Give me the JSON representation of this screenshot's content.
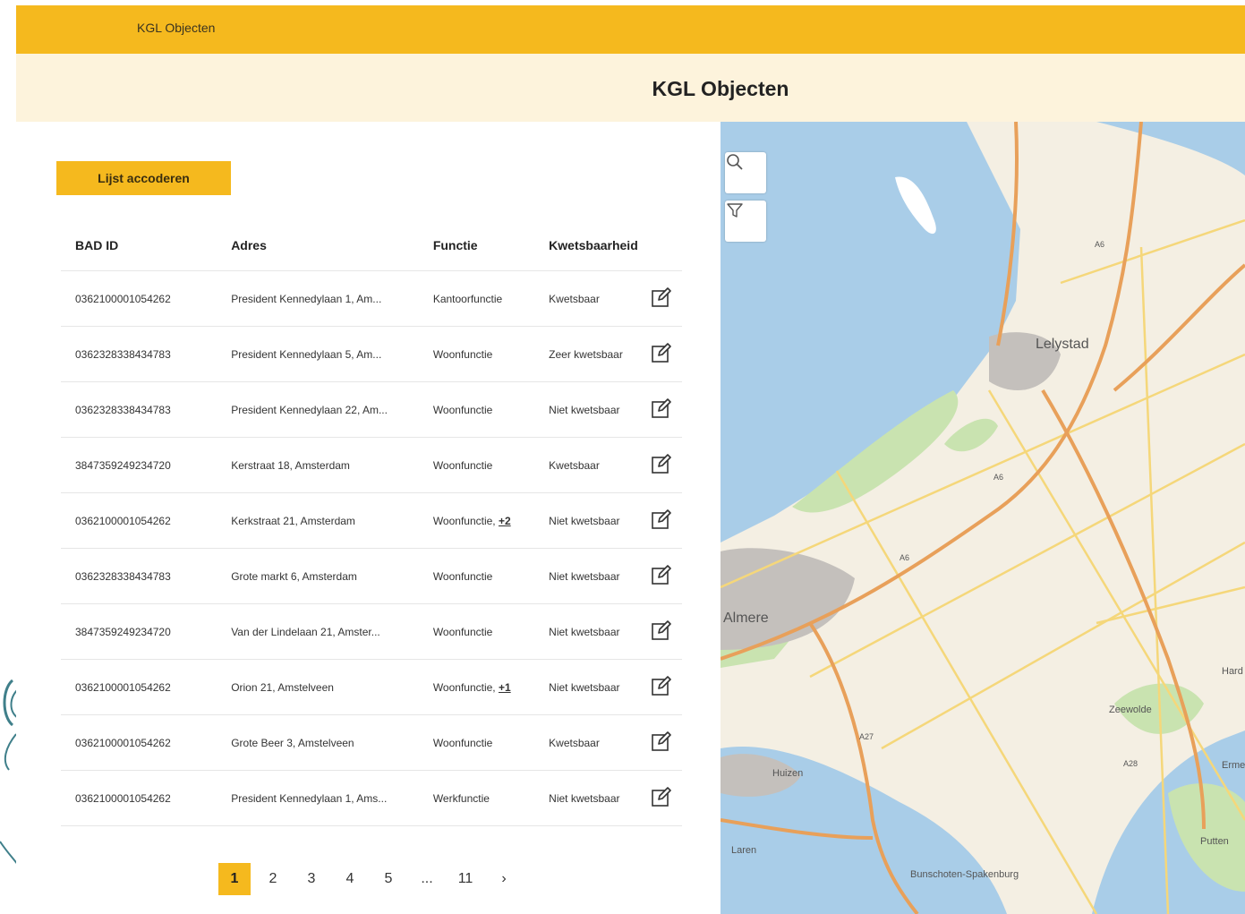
{
  "header": {
    "app_name": "KGL Objecten"
  },
  "page": {
    "title": "KGL Objecten"
  },
  "actions": {
    "accept_label": "Lijst accoderen"
  },
  "table": {
    "columns": [
      "BAD ID",
      "Adres",
      "Functie",
      "Kwetsbaarheid"
    ],
    "rows": [
      {
        "id": "0362100001054262",
        "address": "President Kennedylaan 1, Am...",
        "function": "Kantoorfunctie",
        "more": "",
        "vulnerability": "Kwetsbaar"
      },
      {
        "id": "0362328338434783",
        "address": "President Kennedylaan 5, Am...",
        "function": "Woonfunctie",
        "more": "",
        "vulnerability": "Zeer kwetsbaar"
      },
      {
        "id": "0362328338434783",
        "address": "President Kennedylaan 22, Am...",
        "function": "Woonfunctie",
        "more": "",
        "vulnerability": "Niet kwetsbaar"
      },
      {
        "id": "3847359249234720",
        "address": "Kerstraat 18, Amsterdam",
        "function": "Woonfunctie",
        "more": "",
        "vulnerability": "Kwetsbaar"
      },
      {
        "id": "0362100001054262",
        "address": "Kerkstraat 21, Amsterdam",
        "function": "Woonfunctie, ",
        "more": "+2",
        "vulnerability": "Niet kwetsbaar"
      },
      {
        "id": "0362328338434783",
        "address": "Grote markt 6, Amsterdam",
        "function": "Woonfunctie",
        "more": "",
        "vulnerability": "Niet kwetsbaar"
      },
      {
        "id": "3847359249234720",
        "address": "Van der Lindelaan 21, Amster...",
        "function": "Woonfunctie",
        "more": "",
        "vulnerability": "Niet kwetsbaar"
      },
      {
        "id": "0362100001054262",
        "address": "Orion 21, Amstelveen",
        "function": "Woonfunctie, ",
        "more": "+1",
        "vulnerability": "Niet kwetsbaar"
      },
      {
        "id": "0362100001054262",
        "address": "Grote Beer 3, Amstelveen",
        "function": "Woonfunctie",
        "more": "",
        "vulnerability": "Kwetsbaar"
      },
      {
        "id": "0362100001054262",
        "address": "President Kennedylaan 1, Ams...",
        "function": "Werkfunctie",
        "more": "",
        "vulnerability": "Niet kwetsbaar"
      }
    ]
  },
  "pagination": {
    "pages": [
      "1",
      "2",
      "3",
      "4",
      "5"
    ],
    "ellipsis": "...",
    "last": "11",
    "next": "›",
    "current": "1"
  },
  "map": {
    "labels": {
      "lelystad": "Lelystad",
      "almere": "Almere",
      "zeewolde": "Zeewolde",
      "huizen": "Huizen",
      "laren": "Laren",
      "bunschoten": "Bunschoten-Spakenburg",
      "putten": "Putten",
      "ermelo": "Ermel",
      "harderwijk": "Hard"
    },
    "road_labels": {
      "a6_north": "A6",
      "a6_mid": "A6",
      "a6_south": "A6",
      "a27": "A27",
      "a28": "A28"
    },
    "controls": {
      "search_icon": "search-icon",
      "filter_icon": "filter-icon"
    },
    "colors": {
      "water": "#a9cde8",
      "land": "#f4efe3",
      "green": "#c9e3b0",
      "motorway": "#e8a05a",
      "road": "#f5d77a",
      "urban": "#c4c0bc"
    }
  },
  "colors": {
    "accent": "#f5b91e",
    "title_bar": "#fdf3dc"
  }
}
